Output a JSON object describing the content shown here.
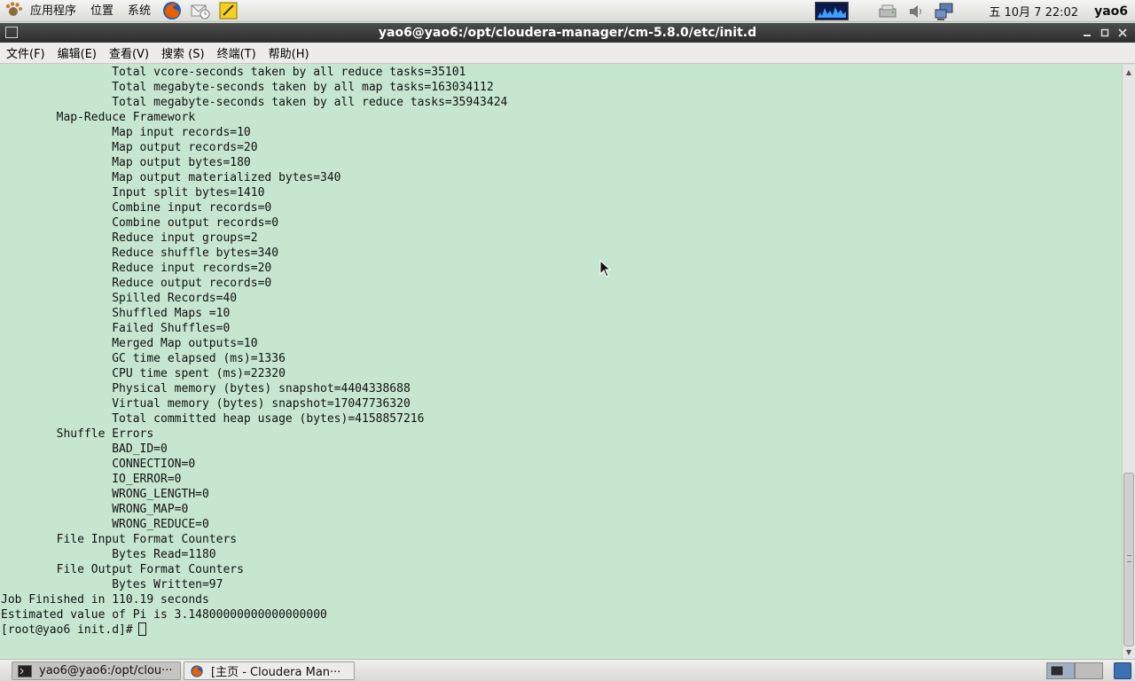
{
  "top_panel": {
    "menus": [
      "应用程序",
      "位置",
      "系统"
    ],
    "launchers": [
      {
        "name": "firefox-icon",
        "color": "#e66000"
      },
      {
        "name": "mail-icon",
        "color": "#9a9a9a"
      },
      {
        "name": "notes-icon",
        "color": "#f2c500"
      }
    ],
    "clock": "五 10月  7 22:02",
    "user": "yao6"
  },
  "window": {
    "title": "yao6@yao6:/opt/cloudera-manager/cm-5.8.0/etc/init.d"
  },
  "menubar": {
    "items": [
      "文件(F)",
      "编辑(E)",
      "查看(V)",
      "搜索 (S)",
      "终端(T)",
      "帮助(H)"
    ]
  },
  "terminal": {
    "lines": [
      "                Total vcore-seconds taken by all reduce tasks=35101",
      "                Total megabyte-seconds taken by all map tasks=163034112",
      "                Total megabyte-seconds taken by all reduce tasks=35943424",
      "        Map-Reduce Framework",
      "                Map input records=10",
      "                Map output records=20",
      "                Map output bytes=180",
      "                Map output materialized bytes=340",
      "                Input split bytes=1410",
      "                Combine input records=0",
      "                Combine output records=0",
      "                Reduce input groups=2",
      "                Reduce shuffle bytes=340",
      "                Reduce input records=20",
      "                Reduce output records=0",
      "                Spilled Records=40",
      "                Shuffled Maps =10",
      "                Failed Shuffles=0",
      "                Merged Map outputs=10",
      "                GC time elapsed (ms)=1336",
      "                CPU time spent (ms)=22320",
      "                Physical memory (bytes) snapshot=4404338688",
      "                Virtual memory (bytes) snapshot=17047736320",
      "                Total committed heap usage (bytes)=4158857216",
      "        Shuffle Errors",
      "                BAD_ID=0",
      "                CONNECTION=0",
      "                IO_ERROR=0",
      "                WRONG_LENGTH=0",
      "                WRONG_MAP=0",
      "                WRONG_REDUCE=0",
      "        File Input Format Counters",
      "                Bytes Read=1180",
      "        File Output Format Counters",
      "                Bytes Written=97",
      "Job Finished in 110.19 seconds",
      "Estimated value of Pi is 3.14800000000000000000"
    ],
    "prompt": "[root@yao6 init.d]#"
  },
  "taskbar": {
    "tasks": [
      {
        "label": "yao6@yao6:/opt/clou···",
        "active": true
      },
      {
        "label": "[主页 - Cloudera Man···",
        "active": false
      }
    ]
  }
}
